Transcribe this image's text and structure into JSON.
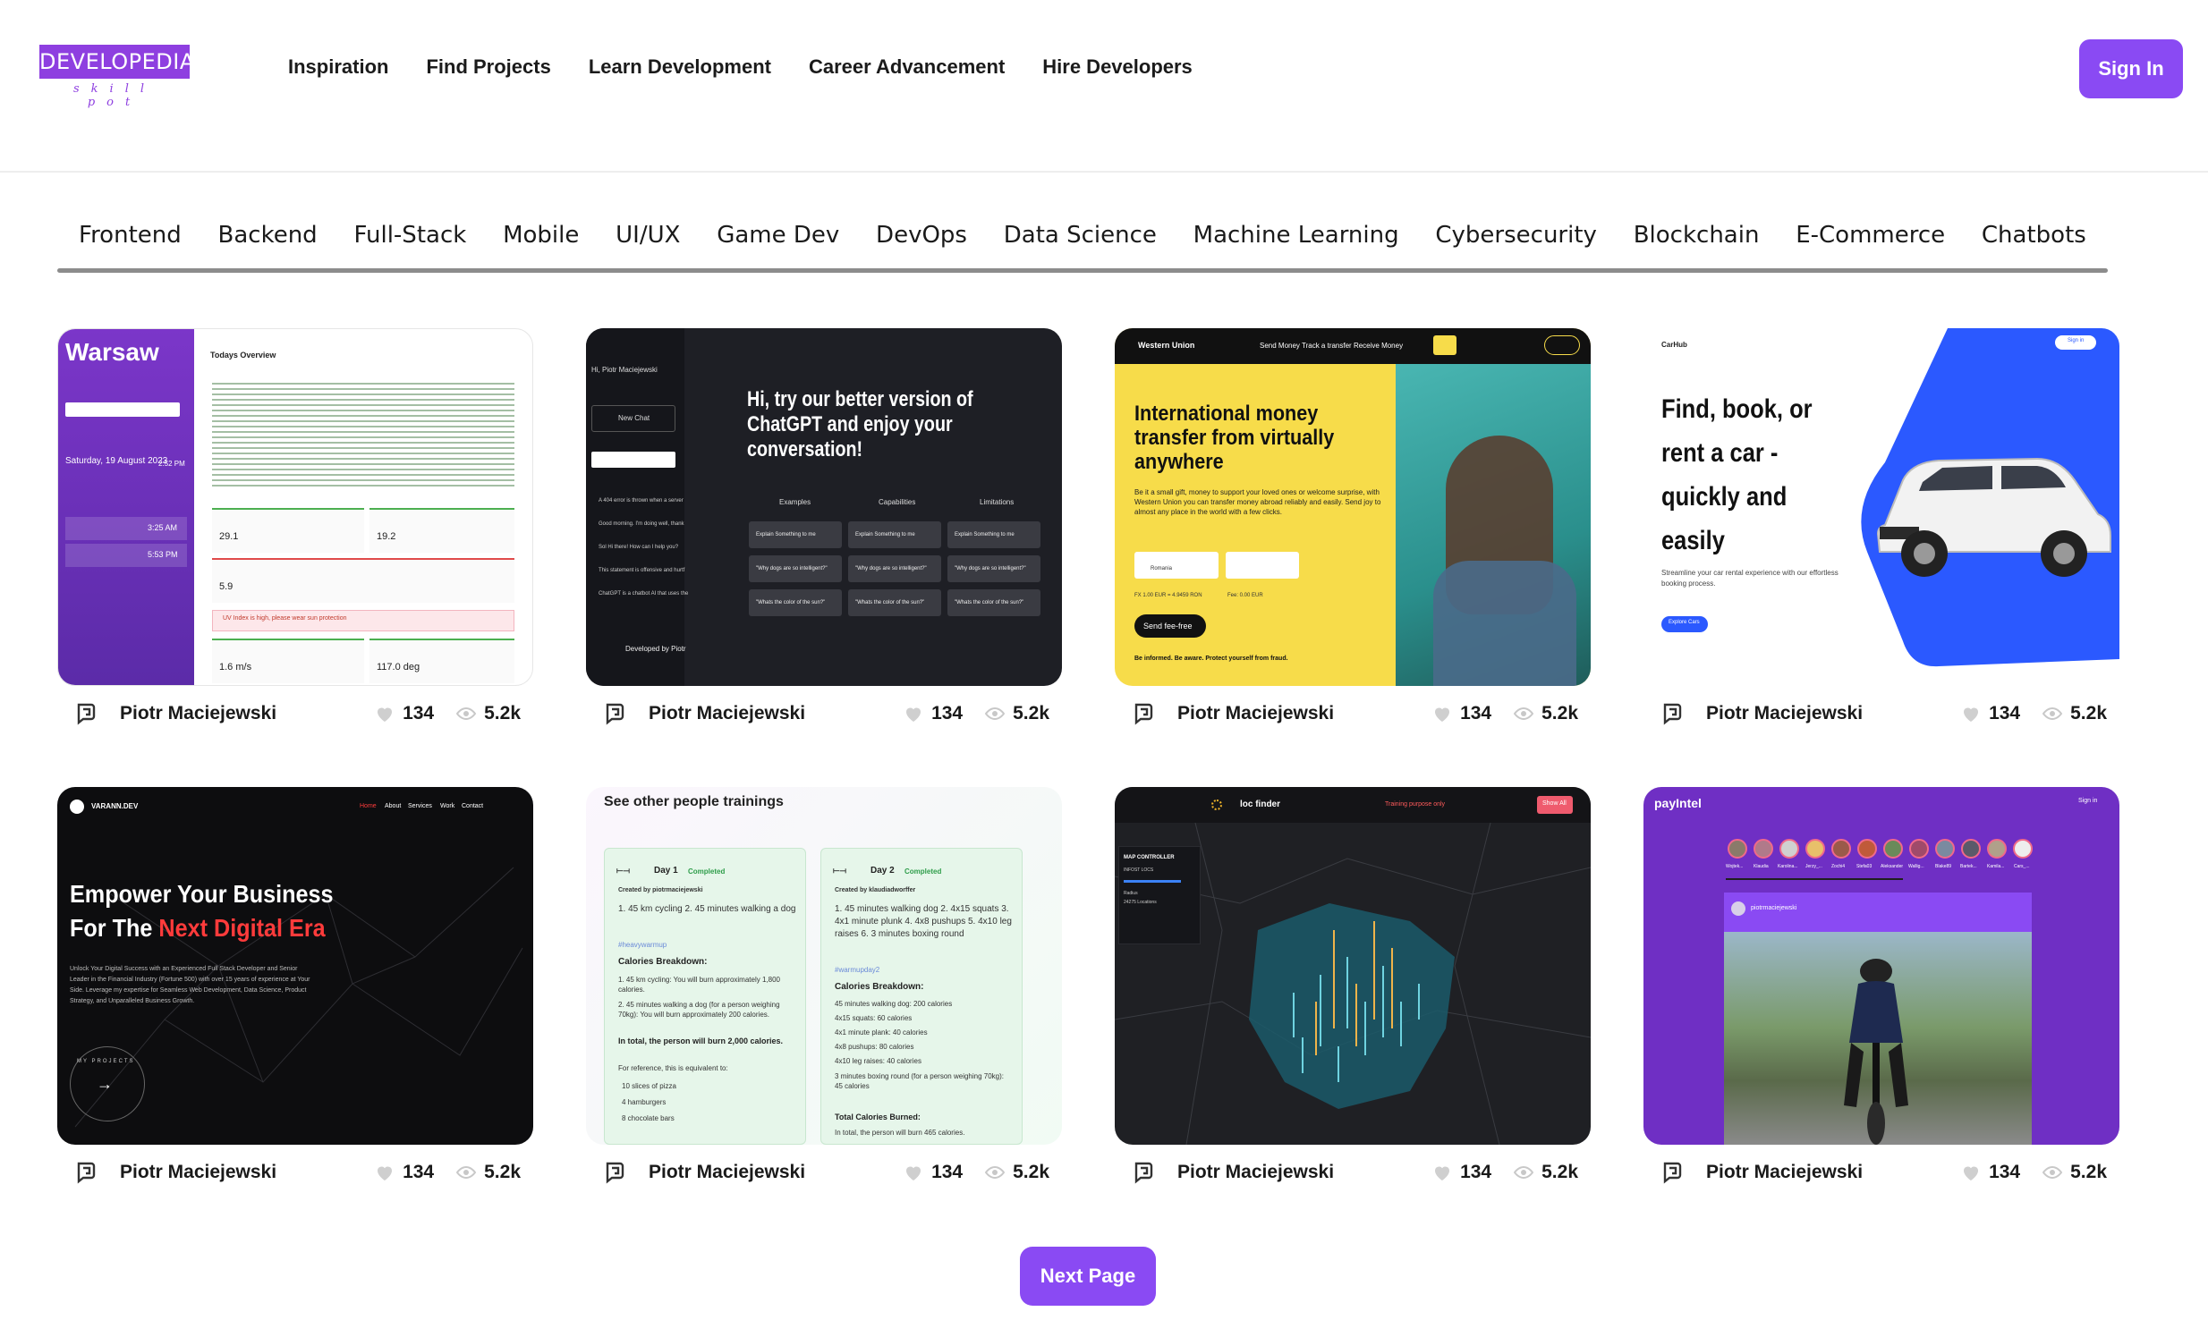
{
  "brand": {
    "name": "DEVELOPEDIA",
    "tagline": "skill pot"
  },
  "nav": [
    "Inspiration",
    "Find Projects",
    "Learn Development",
    "Career Advancement",
    "Hire Developers"
  ],
  "signin_label": "Sign In",
  "categories": [
    "Frontend",
    "Backend",
    "Full-Stack",
    "Mobile",
    "UI/UX",
    "Game Dev",
    "DevOps",
    "Data Science",
    "Machine Learning",
    "Cybersecurity",
    "Blockchain",
    "E-Commerce",
    "Chatbots"
  ],
  "accent": "#8a4af3",
  "cards": [
    {
      "author": "Piotr Maciejewski",
      "likes": "134",
      "views": "5.2k",
      "preview": {
        "city": "Warsaw",
        "overview": "Todays Overview",
        "date": "Saturday, 19 August 2023",
        "time": "2:52 PM",
        "sunrise": "3:25 AM",
        "sunset": "5:53 PM",
        "stat1": "29.1",
        "stat2": "19.2",
        "stat3": "5.9",
        "wind_speed": "1.6 m/s",
        "wind_dir": "117.0 deg",
        "alert": "UV Index is high, please wear sun protection"
      }
    },
    {
      "author": "Piotr Maciejewski",
      "likes": "134",
      "views": "5.2k",
      "preview": {
        "greeting": "Hi, Piotr Maciejewski",
        "new_chat": "New Chat",
        "headline": "Hi, try our better version of ChatGPT and enjoy your conversation!",
        "cols": [
          "Examples",
          "Capabilities",
          "Limitations"
        ],
        "row1": "Explain Something to me",
        "row2": "\"Why dogs are so intelligent?\"",
        "row3": "\"Whats the color of the sun?\"",
        "history": [
          "A 404 error is thrown when a server",
          "Good morning. I'm doing well, thank",
          "Sol Hi there! How can I help you?",
          "This statement is offensive and hurtf",
          "ChatGPT is a chatbot AI that uses the"
        ],
        "footer": "Developed by Piotr"
      }
    },
    {
      "author": "Piotr Maciejewski",
      "likes": "134",
      "views": "5.2k",
      "preview": {
        "brand": "Western Union",
        "nav": "Send Money   Track a transfer   Receive Money",
        "headline": "International money transfer from virtually anywhere",
        "body": "Be it a small gift, money to support your loved ones or welcome surprise, with Western Union you can transfer money abroad reliably and easily. Send joy to almost any place in the world with a few clicks.",
        "country": "Romania",
        "rate": "FX 1.00 EUR = 4.9459 RON",
        "fee": "Fee: 0.00 EUR",
        "button": "Send fee-free",
        "informed": "Be informed. Be aware. Protect yourself from fraud."
      }
    },
    {
      "author": "Piotr Maciejewski",
      "likes": "134",
      "views": "5.2k",
      "preview": {
        "brand": "CarHub",
        "signin": "Sign in",
        "headline": "Find, book, or rent a car - quickly and easily",
        "sub": "Streamline your car rental experience with our effortless booking process.",
        "button": "Explore Cars"
      }
    },
    {
      "author": "Piotr Maciejewski",
      "likes": "134",
      "views": "5.2k",
      "preview": {
        "brand": "VARANN.DEV",
        "nav": [
          "Home",
          "About",
          "Services",
          "Work",
          "Contact"
        ],
        "headline1": "Empower Your Business",
        "headline2a": "For The ",
        "headline2b": "Next Digital Era",
        "body": "Unlock Your Digital Success with an Experienced Full Stack Developer and Senior Leader in the Financial Industry (Fortune 500) with over 15 years of experience at Your Side. Leverage my expertise for Seamless Web Development, Data Science, Product Strategy, and Unparalleled Business Growth.",
        "badge": "MY PROJECTS"
      }
    },
    {
      "author": "Piotr Maciejewski",
      "likes": "134",
      "views": "5.2k",
      "preview": {
        "title": "See other people trainings",
        "day1": "Day 1",
        "day2": "Day 2",
        "status": "Completed",
        "by1": "Created by piotrmaciejewski",
        "by2": "Created by klaudiadworffer",
        "desc1": "1. 45 km cycling 2. 45 minutes walking a dog",
        "tag1": "#heavywarmup",
        "desc2": "1. 45 minutes walking dog 2. 4x15 squats 3. 4x1 minute plunk 4. 4x8 pushups 5. 4x10 leg raises 6. 3 minutes boxing round",
        "tag2": "#warmupday2",
        "cb": "Calories Breakdown:",
        "list1": [
          "1. 45 km cycling: You will burn approximately 1,800 calories.",
          "2. 45 minutes walking a dog (for a person weighing 70kg): You will burn approximately 200 calories."
        ],
        "total1": "In total, the person will burn 2,000 calories.",
        "ref": "For reference, this is equivalent to:",
        "eq": [
          "10 slices of pizza",
          "4 hamburgers",
          "8 chocolate bars"
        ],
        "list2": [
          "45 minutes walking dog: 200 calories",
          "4x15 squats: 60 calories",
          "4x1 minute plank: 40 calories",
          "4x8 pushups: 80 calories",
          "4x10 leg raises: 40 calories",
          "3 minutes boxing round (for a person weighing 70kg): 45 calories"
        ],
        "tcb": "Total Calories Burned:",
        "total2": "In total, the person will burn 465 calories."
      }
    },
    {
      "author": "Piotr Maciejewski",
      "likes": "134",
      "views": "5.2k",
      "preview": {
        "brand": "loc finder",
        "banner": "Training purpose only",
        "button": "Show All",
        "panel_title": "MAP CONTROLLER",
        "panel_sub": "INFOST LOCS",
        "radius": "Radius",
        "locs": "24275 Locations"
      }
    },
    {
      "author": "Piotr Maciejewski",
      "likes": "134",
      "views": "5.2k",
      "preview": {
        "brand": "payIntel",
        "signin": "Sign in",
        "stories": [
          "Wojtek...",
          "Klaudia",
          "Karolina...",
          "Jerzy_...",
          "Zochi4",
          "Stefa03",
          "Aleksander",
          "Wallig...",
          "Blake89",
          "Bartek...",
          "Kamila...",
          "Cars_..."
        ],
        "post_user": "piotrmaciejewski"
      }
    }
  ],
  "next_label": "Next Page"
}
